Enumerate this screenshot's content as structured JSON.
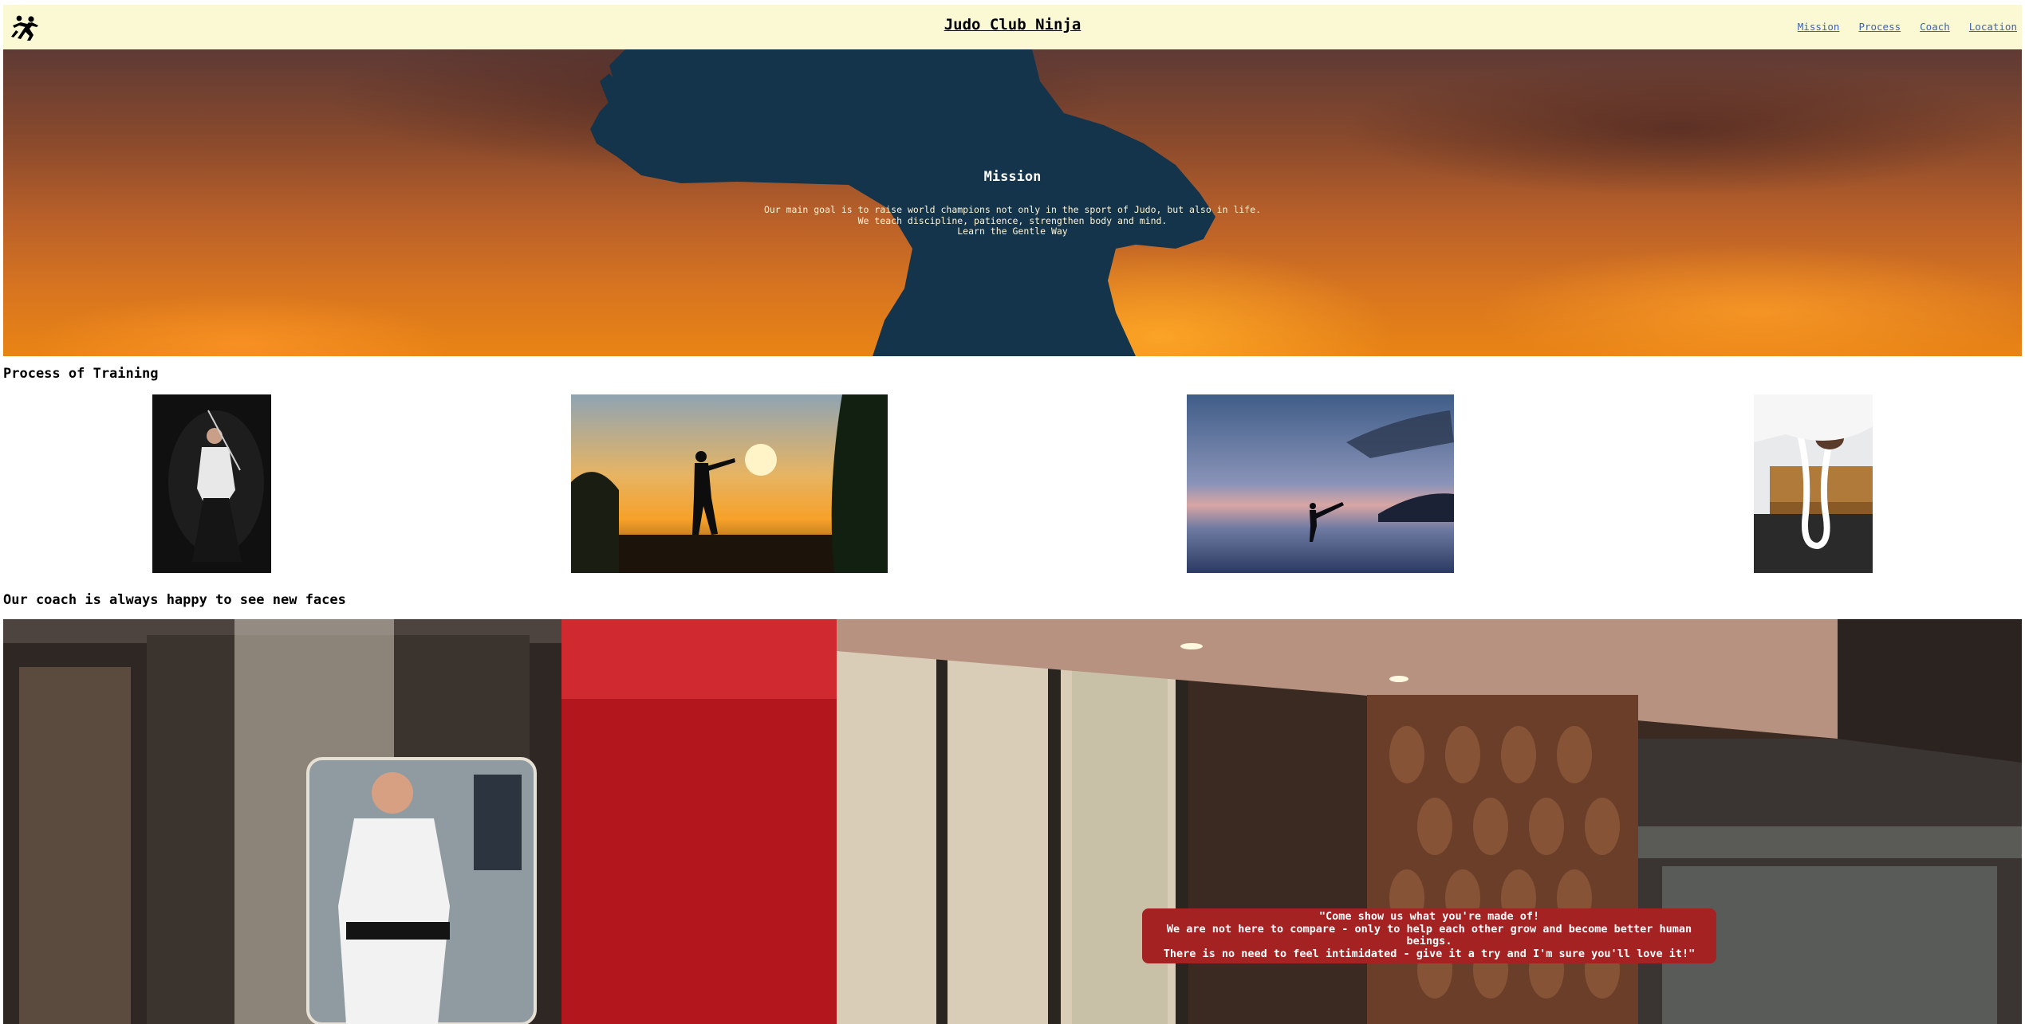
{
  "header": {
    "title": "Judo Club Ninja",
    "nav": [
      "Mission",
      "Process",
      "Coach",
      "Location"
    ]
  },
  "mission": {
    "title": "Mission",
    "lines": [
      "Our main goal is to raise world champions not only in the sport of Judo, but also in life.",
      "We teach discipline, patience, strengthen body and mind.",
      "Learn the Gentle Way"
    ]
  },
  "process": {
    "heading": "Process of Training"
  },
  "coach": {
    "heading": "Our coach is always happy to see new faces",
    "quote": [
      "\"Come show us what you're made of!",
      "We are not here to compare - only to help each other grow and become better human beings.",
      "There is no need to feel intimidated - give it a try and I'm sure you'll love it!\""
    ]
  },
  "colors": {
    "header_bg": "#fbf9d3",
    "nav_link": "#3a63b4",
    "silhouette": "#13344a",
    "quote_bg": "#a52222"
  }
}
